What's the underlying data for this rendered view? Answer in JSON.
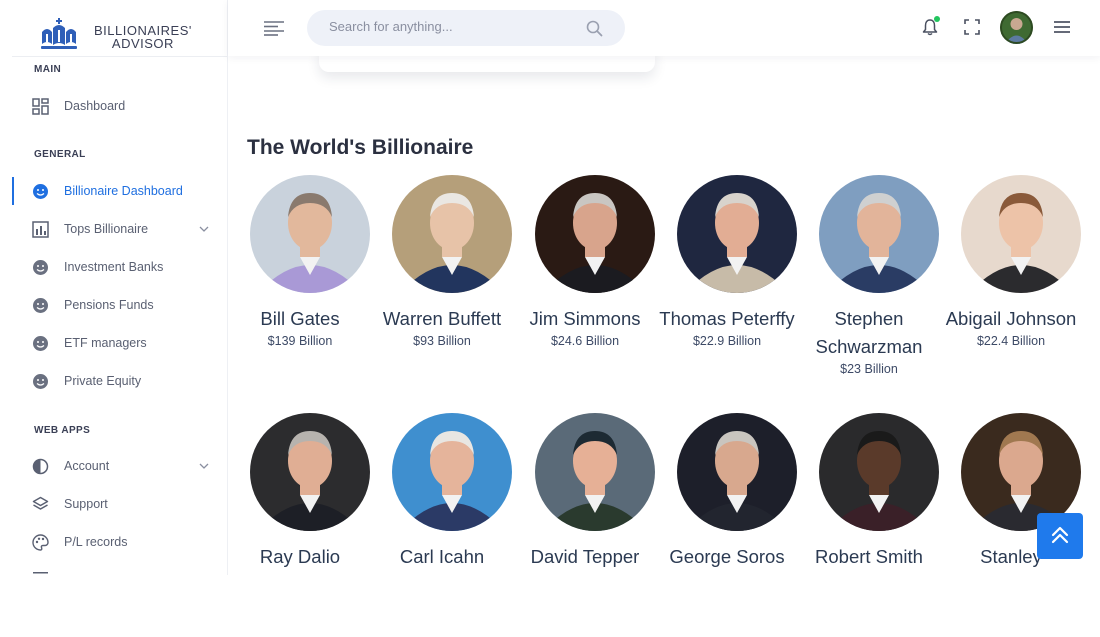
{
  "brand": {
    "line1": "BILLIONAIRES'",
    "line2": "ADVISOR"
  },
  "search": {
    "placeholder": "Search for anything..."
  },
  "sidebar": {
    "sections": [
      {
        "label": "MAIN"
      },
      {
        "label": "GENERAL"
      },
      {
        "label": "WEB APPS"
      }
    ],
    "items": [
      {
        "label": "Dashboard",
        "icon": "grid-icon"
      },
      {
        "label": "Billionaire Dashboard",
        "icon": "smiley-icon",
        "active": true
      },
      {
        "label": "Tops Billionaire",
        "icon": "bar-chart-icon",
        "has_submenu": true
      },
      {
        "label": "Investment Banks",
        "icon": "smiley-icon"
      },
      {
        "label": "Pensions Funds",
        "icon": "smiley-icon"
      },
      {
        "label": "ETF managers",
        "icon": "smiley-icon"
      },
      {
        "label": "Private Equity",
        "icon": "smiley-icon"
      },
      {
        "label": "Account",
        "icon": "pie-icon",
        "has_submenu": true
      },
      {
        "label": "Support",
        "icon": "layers-icon"
      },
      {
        "label": "P/L records",
        "icon": "palette-icon"
      }
    ]
  },
  "main": {
    "title": "The World's Billionaire",
    "billionaires": [
      {
        "name": "Bill Gates",
        "worth": "$139 Billion",
        "bg": "#c9d2dc",
        "skin": "#e2b89c",
        "hair": "#8a7a6e",
        "suit": "#a999d6"
      },
      {
        "name": "Warren Buffett",
        "worth": "$93 Billion",
        "bg": "#b59f7a",
        "skin": "#e7c3a8",
        "hair": "#eae7e2",
        "suit": "#22355e"
      },
      {
        "name": "Jim Simmons",
        "worth": "$24.6 Billion",
        "bg": "#2a1a14",
        "skin": "#d8a48c",
        "hair": "#c9c6c2",
        "suit": "#1b1b20"
      },
      {
        "name": "Thomas Peterffy",
        "worth": "$22.9 Billion",
        "bg": "#1f2740",
        "skin": "#e2ad94",
        "hair": "#d8d3cc",
        "suit": "#c7bba8"
      },
      {
        "name": "Stephen Schwarzman",
        "worth": "$23 Billion",
        "bg": "#7f9ec0",
        "skin": "#e2b49a",
        "hair": "#cfd0d0",
        "suit": "#2a3c64"
      },
      {
        "name": "Abigail Johnson",
        "worth": "$22.4 Billion",
        "bg": "#e7d9cd",
        "skin": "#edc3a8",
        "hair": "#8a5a3a",
        "suit": "#2b2b2e"
      },
      {
        "name": "Ray Dalio",
        "worth": "",
        "bg": "#2c2c2e",
        "skin": "#e0ae94",
        "hair": "#b7b3ae",
        "suit": "#1d1f26"
      },
      {
        "name": "Carl Icahn",
        "worth": "",
        "bg": "#3f8fcf",
        "skin": "#e5b49b",
        "hair": "#e8e6e2",
        "suit": "#2b3a66"
      },
      {
        "name": "David Tepper",
        "worth": "",
        "bg": "#5a6a78",
        "skin": "#e6b096",
        "hair": "#1d2a33",
        "suit": "#2a3a2e"
      },
      {
        "name": "George Soros",
        "worth": "",
        "bg": "#1d1f2a",
        "skin": "#d8a88e",
        "hair": "#c9c5bf",
        "suit": "#22252f"
      },
      {
        "name": "Robert Smith",
        "worth": "",
        "bg": "#2a2a2c",
        "skin": "#5a3a2a",
        "hair": "#1a1a1a",
        "suit": "#3a2028"
      },
      {
        "name": "Stanley",
        "worth": "",
        "bg": "#3a2a1e",
        "skin": "#dba88e",
        "hair": "#a07850",
        "suit": "#2a2a30"
      }
    ]
  },
  "colors": {
    "accent": "#1f7aec",
    "active_nav": "#1f6fe0",
    "notification": "#22c55e"
  }
}
